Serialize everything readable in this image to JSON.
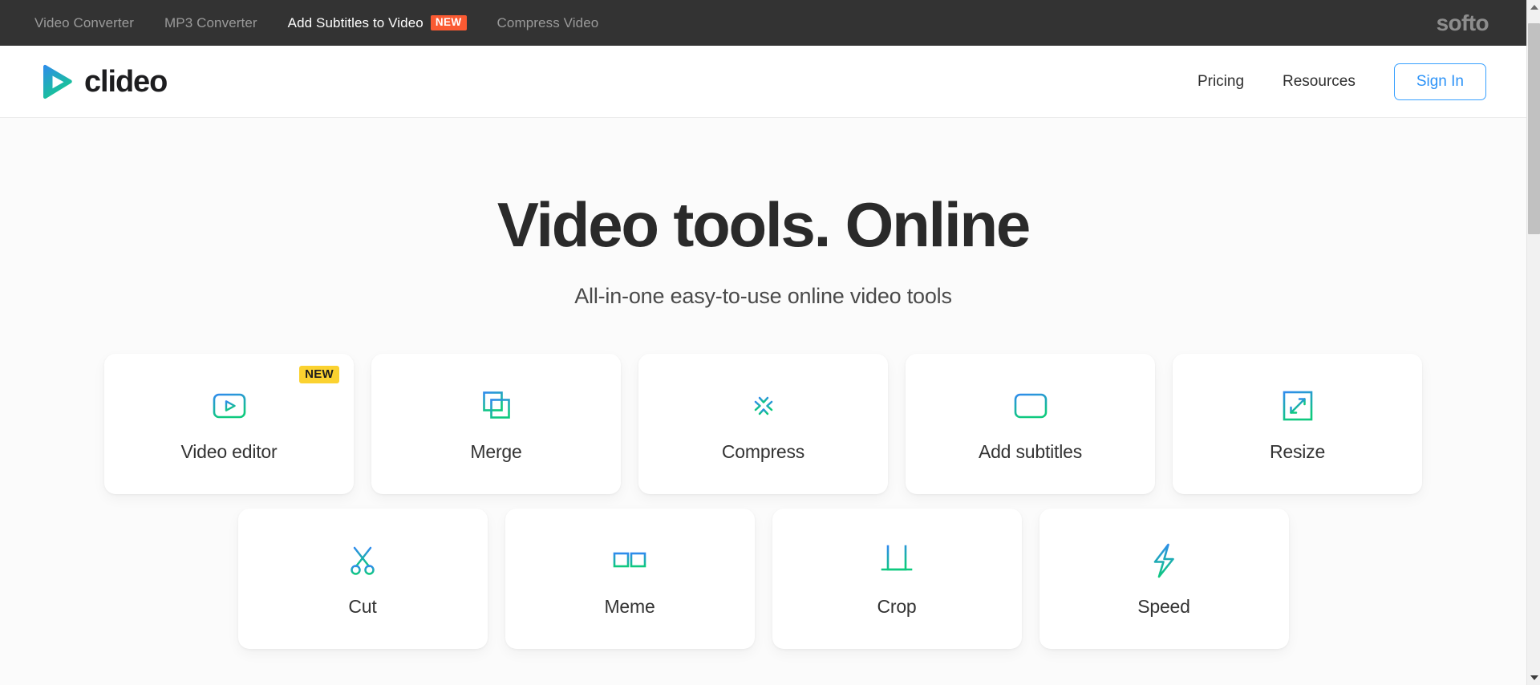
{
  "topbar": {
    "links": [
      {
        "label": "Video Converter",
        "active": false,
        "badge": null
      },
      {
        "label": "MP3 Converter",
        "active": false,
        "badge": null
      },
      {
        "label": "Add Subtitles to Video",
        "active": true,
        "badge": "NEW"
      },
      {
        "label": "Compress Video",
        "active": false,
        "badge": null
      }
    ],
    "brand": "softo",
    "background_color": "#333333",
    "badge_color": "#fa5a32"
  },
  "header": {
    "logo_text": "clideo",
    "logo_icon": "play-triangle-gradient-icon",
    "nav": [
      {
        "label": "Pricing"
      },
      {
        "label": "Resources"
      }
    ],
    "signin_label": "Sign In",
    "signin_color": "#2d93f7"
  },
  "hero": {
    "title": "Video tools. Online",
    "subtitle": "All-in-one easy-to-use online video tools"
  },
  "tools": {
    "row1": [
      {
        "label": "Video editor",
        "icon": "video-editor-icon",
        "badge": "NEW"
      },
      {
        "label": "Merge",
        "icon": "merge-icon",
        "badge": null
      },
      {
        "label": "Compress",
        "icon": "compress-icon",
        "badge": null
      },
      {
        "label": "Add subtitles",
        "icon": "add-subtitles-icon",
        "badge": null
      },
      {
        "label": "Resize",
        "icon": "resize-icon",
        "badge": null
      }
    ],
    "row2": [
      {
        "label": "Cut",
        "icon": "scissors-icon",
        "badge": null
      },
      {
        "label": "Meme",
        "icon": "glasses-icon",
        "badge": null
      },
      {
        "label": "Crop",
        "icon": "crop-icon",
        "badge": null
      },
      {
        "label": "Speed",
        "icon": "lightning-bolt-icon",
        "badge": null
      }
    ],
    "badge_color": "#fbd230",
    "gradient_start": "#2f8bed",
    "gradient_end": "#0ec97f"
  },
  "scrollbar": {
    "up_icon": "scroll-up-arrow-icon",
    "down_icon": "scroll-down-arrow-icon",
    "thumb": "vertical-scrollbar-thumb"
  }
}
